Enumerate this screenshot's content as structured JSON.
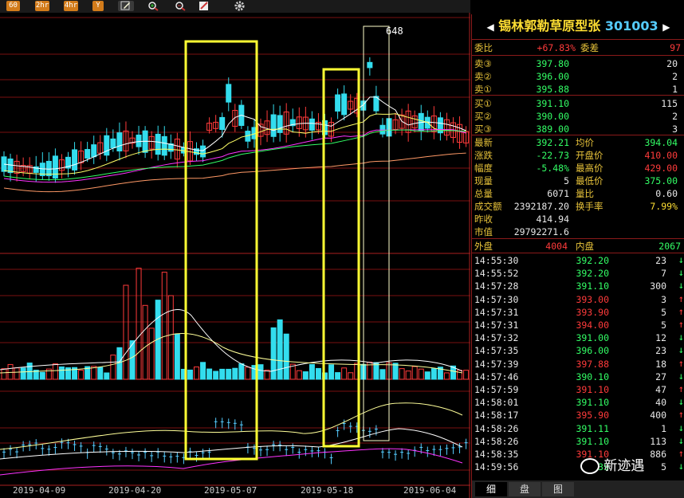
{
  "toolbar": {
    "buttons": [
      {
        "label": "60",
        "style": "orange"
      },
      {
        "label": "2hr",
        "style": "orange"
      },
      {
        "label": "4hr",
        "style": "orange"
      },
      {
        "label": "Y",
        "style": "orange"
      }
    ],
    "tools": [
      "edit-icon",
      "zoom-in-icon",
      "zoom-out-icon",
      "pen-icon",
      "gear-icon"
    ]
  },
  "chart": {
    "peak_label": "648",
    "dates": [
      "2019-04-09",
      "2019-04-20",
      "2019-05-07",
      "2019-05-18",
      "2019-06-04"
    ],
    "colors": {
      "up": "#ff3b3b",
      "down": "#33ddee",
      "ma5": "#ffffff",
      "ma10": "#ffff66",
      "ma20": "#ff33ff",
      "ma30": "#33ff66",
      "ma60": "#ff9966",
      "box": "#ffff33"
    }
  },
  "quote": {
    "name": "锡林郭勒草原型张",
    "code": "301003",
    "weibi_label": "委比",
    "weibi_value": "+67.83%",
    "weicha_label": "委差",
    "weicha_value": "97",
    "asks": [
      {
        "label": "卖③",
        "price": "397.80",
        "vol": "20"
      },
      {
        "label": "卖②",
        "price": "396.00",
        "vol": "2"
      },
      {
        "label": "卖①",
        "price": "395.88",
        "vol": "1"
      }
    ],
    "bids": [
      {
        "label": "买①",
        "price": "391.10",
        "vol": "115"
      },
      {
        "label": "买②",
        "price": "390.00",
        "vol": "2"
      },
      {
        "label": "买③",
        "price": "389.00",
        "vol": "3"
      }
    ],
    "stats": [
      {
        "l1": "最新",
        "v1": "392.21",
        "c1": "green",
        "l2": "均价",
        "v2": "394.04",
        "c2": "green"
      },
      {
        "l1": "涨跌",
        "v1": "-22.73",
        "c1": "green",
        "l2": "开盘价",
        "v2": "410.00",
        "c2": "red"
      },
      {
        "l1": "幅度",
        "v1": "-5.48%",
        "c1": "green",
        "l2": "最高价",
        "v2": "429.00",
        "c2": "red"
      },
      {
        "l1": "现量",
        "v1": "5",
        "c1": "white",
        "l2": "最低价",
        "v2": "375.00",
        "c2": "green"
      },
      {
        "l1": "总量",
        "v1": "6071",
        "c1": "white",
        "l2": "量比",
        "v2": "0.60",
        "c2": "white"
      },
      {
        "l1": "成交额",
        "v1": "2392187.20",
        "c1": "white",
        "l2": "换手率",
        "v2": "7.99%",
        "c2": "yellow"
      },
      {
        "l1": "昨收",
        "v1": "414.94",
        "c1": "white",
        "l2": "",
        "v2": "",
        "c2": "white"
      },
      {
        "l1": "市值",
        "v1": "29792271.6",
        "c1": "white",
        "l2": "",
        "v2": "",
        "c2": "white"
      }
    ],
    "outer_label": "外盘",
    "outer_value": "4004",
    "inner_label": "内盘",
    "inner_value": "2067"
  },
  "ticks": [
    {
      "time": "14:55:30",
      "price": "392.20",
      "vol": "23",
      "dir": "down"
    },
    {
      "time": "14:55:52",
      "price": "392.20",
      "vol": "7",
      "dir": "down"
    },
    {
      "time": "14:57:28",
      "price": "391.10",
      "vol": "300",
      "dir": "down"
    },
    {
      "time": "14:57:30",
      "price": "393.00",
      "vol": "3",
      "dir": "up"
    },
    {
      "time": "14:57:31",
      "price": "393.90",
      "vol": "5",
      "dir": "up"
    },
    {
      "time": "14:57:31",
      "price": "394.00",
      "vol": "5",
      "dir": "up"
    },
    {
      "time": "14:57:32",
      "price": "391.00",
      "vol": "12",
      "dir": "down"
    },
    {
      "time": "14:57:35",
      "price": "396.00",
      "vol": "23",
      "dir": "down"
    },
    {
      "time": "14:57:39",
      "price": "397.88",
      "vol": "18",
      "dir": "up"
    },
    {
      "time": "14:57:46",
      "price": "390.10",
      "vol": "27",
      "dir": "down"
    },
    {
      "time": "14:57:59",
      "price": "391.10",
      "vol": "47",
      "dir": "up"
    },
    {
      "time": "14:58:01",
      "price": "391.10",
      "vol": "40",
      "dir": "down"
    },
    {
      "time": "14:58:17",
      "price": "395.90",
      "vol": "400",
      "dir": "up"
    },
    {
      "time": "14:58:26",
      "price": "391.11",
      "vol": "1",
      "dir": "down"
    },
    {
      "time": "14:58:26",
      "price": "391.10",
      "vol": "113",
      "dir": "down"
    },
    {
      "time": "14:58:35",
      "price": "391.10",
      "vol": "886",
      "dir": "up"
    },
    {
      "time": "14:59:56",
      "price": "39",
      "vol": "5",
      "dir": "down"
    }
  ],
  "tabs": [
    "细",
    "盘",
    "图"
  ],
  "watermark": "新迹遇"
}
